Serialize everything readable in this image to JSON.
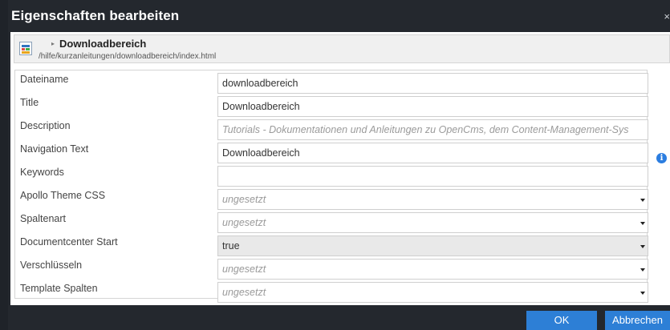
{
  "dialog": {
    "title": "Eigenschaften bearbeiten",
    "close_symbol": "×"
  },
  "resource": {
    "icon": "page-icon",
    "arrow_symbol": "▸",
    "title": "Downloadbereich",
    "path": "/hilfe/kurzanleitungen/downloadbereich/index.html"
  },
  "fields": [
    {
      "label": "Dateiname",
      "value": "downloadbereich",
      "type": "text"
    },
    {
      "label": "Title",
      "value": "Downloadbereich",
      "type": "text"
    },
    {
      "label": "Description",
      "value": "Tutorials - Dokumentationen und Anleitungen zu OpenCms, dem Content-Management-Sys",
      "type": "placeholder"
    },
    {
      "label": "Navigation Text",
      "value": "Downloadbereich",
      "type": "text"
    },
    {
      "label": "Keywords",
      "value": "",
      "type": "text"
    },
    {
      "label": "Apollo Theme CSS",
      "value": "ungesetzt",
      "type": "select"
    },
    {
      "label": "Spaltenart",
      "value": "ungesetzt",
      "type": "select"
    },
    {
      "label": "Documentcenter Start",
      "value": "true",
      "type": "select-active"
    },
    {
      "label": "Verschlüsseln",
      "value": "ungesetzt",
      "type": "select"
    },
    {
      "label": "Template Spalten",
      "value": "ungesetzt",
      "type": "select"
    }
  ],
  "info_icon": {
    "symbol": "i",
    "icon": "info-icon"
  },
  "buttons": {
    "ok": "OK",
    "cancel": "Abbrechen"
  },
  "colors": {
    "dialog_bg": "#24282e",
    "button": "#2d7fd6",
    "info": "#2b7de0"
  }
}
